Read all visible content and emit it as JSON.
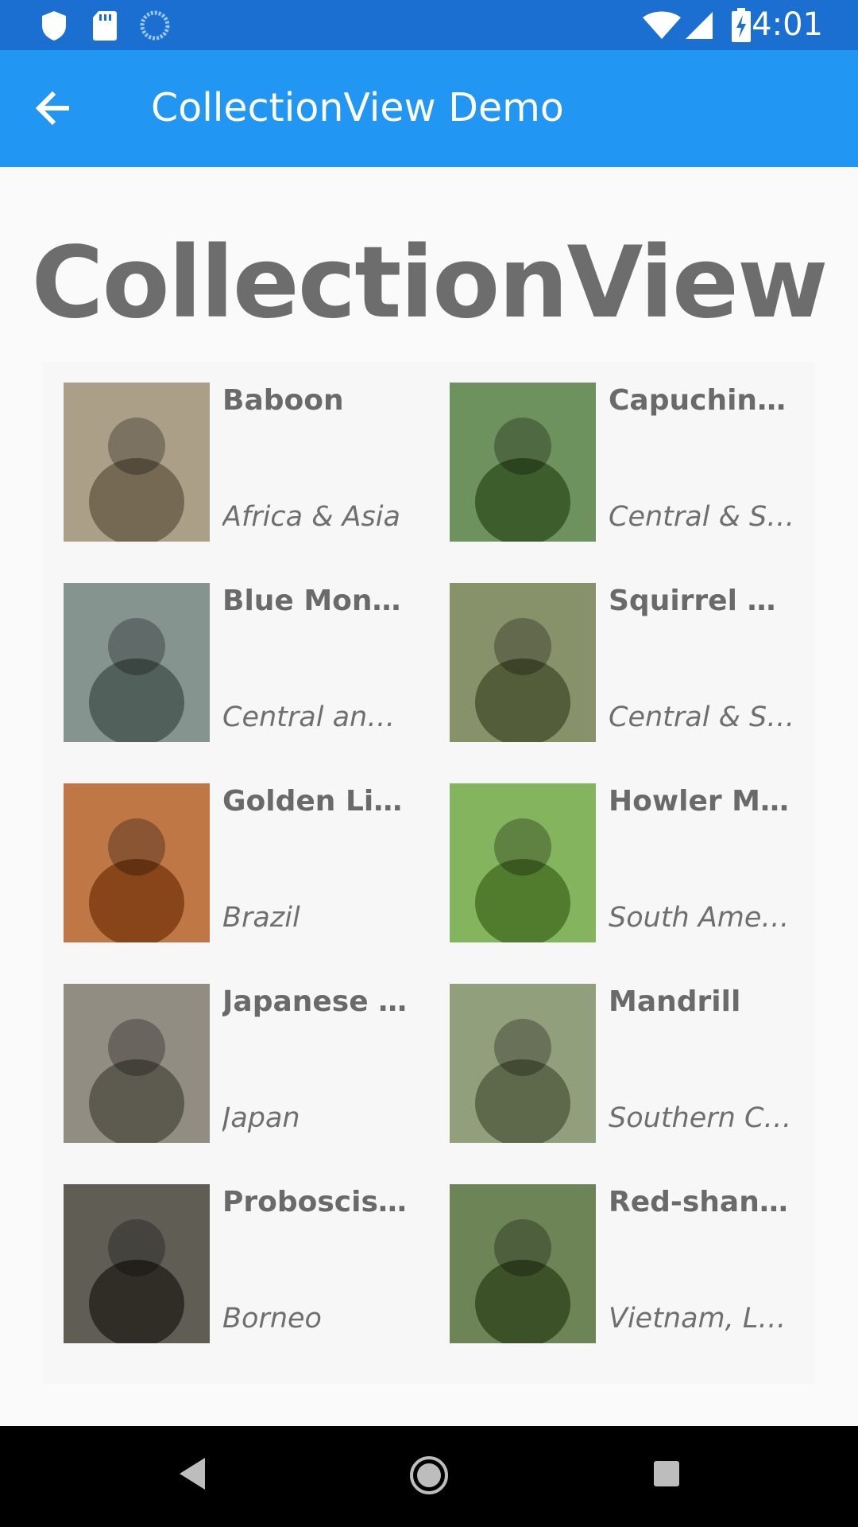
{
  "status_bar": {
    "time": "4:01",
    "icons": [
      "shield-icon",
      "sd-card-icon",
      "sync-icon",
      "wifi-icon",
      "signal-icon",
      "battery-charging-icon"
    ]
  },
  "app_bar": {
    "title": "CollectionView Demo",
    "back_icon": "arrow-back-icon"
  },
  "page": {
    "heading": "CollectionView"
  },
  "monkeys": [
    {
      "name": "Baboon",
      "location": "Africa & Asia",
      "color": "#9a8a6e"
    },
    {
      "name": "Capuchin Monkey",
      "location": "Central & South America",
      "color": "#4f7a3a"
    },
    {
      "name": "Blue Monkey",
      "location": "Central and East Africa",
      "color": "#6c7d78"
    },
    {
      "name": "Squirrel Monkey",
      "location": "Central & South America",
      "color": "#6e7a4a"
    },
    {
      "name": "Golden Lion Tamarin",
      "location": "Brazil",
      "color": "#b25a1e"
    },
    {
      "name": "Howler Monkey",
      "location": "South America",
      "color": "#6aa43a"
    },
    {
      "name": "Japanese Macaque",
      "location": "Japan",
      "color": "#7a7568"
    },
    {
      "name": "Mandrill",
      "location": "Southern Cameroon, Gabon, and Congo",
      "color": "#7a8a60"
    },
    {
      "name": "Proboscis Monkey",
      "location": "Borneo",
      "color": "#3d3a30"
    },
    {
      "name": "Red-shanked Douc",
      "location": "Vietnam, Laos",
      "color": "#4d6a32"
    }
  ],
  "nav_bar": {
    "back_icon": "nav-back-icon",
    "home_icon": "nav-home-icon",
    "recents_icon": "nav-recents-icon"
  }
}
